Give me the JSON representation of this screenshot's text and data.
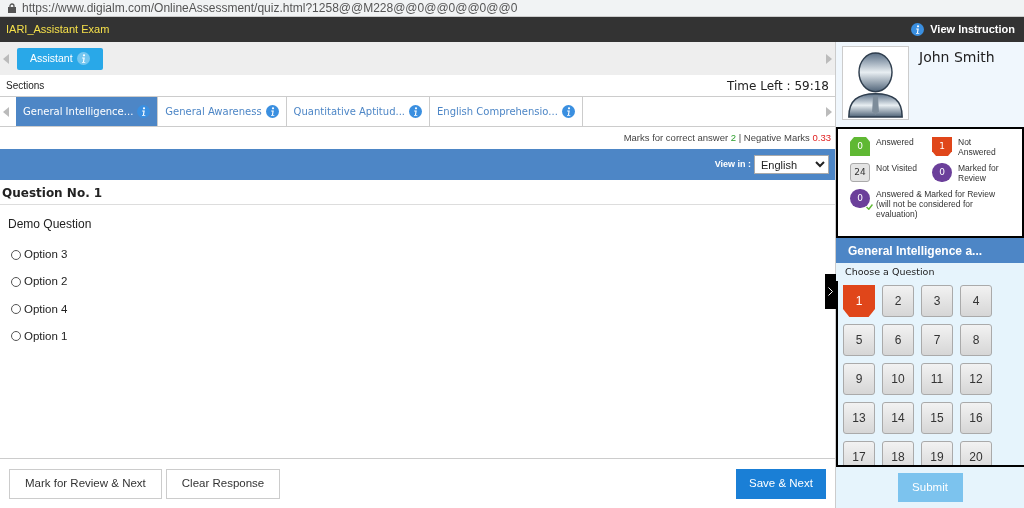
{
  "address_bar": {
    "url": "https://www.digialm.com/OnlineAssessment/quiz.html?1258@@M228@@0@@0@@0@@0"
  },
  "header": {
    "exam_title": "IARI_Assistant Exam",
    "instructions_link": "View Instruction"
  },
  "groups": [
    {
      "label": "Assistant",
      "selected": true
    }
  ],
  "sections_label": "Sections",
  "time_left": "Time Left : 59:18",
  "section_tabs": [
    {
      "label": "General Intelligence...",
      "selected": true
    },
    {
      "label": "General Awareness",
      "selected": false
    },
    {
      "label": "Quantitative Aptitud...",
      "selected": false
    },
    {
      "label": "English Comprehensio...",
      "selected": false
    }
  ],
  "marks": {
    "correct_label": "Marks for correct answer",
    "correct_value": "2",
    "separator": "|",
    "negative_label": "Negative Marks",
    "negative_value": "0.33"
  },
  "view_in": {
    "label": "View in :",
    "value": "English"
  },
  "question": {
    "number": "Question No. 1",
    "text": "Demo Question",
    "options": [
      {
        "label": "Option 3",
        "selected": false
      },
      {
        "label": "Option 2",
        "selected": false
      },
      {
        "label": "Option 4",
        "selected": false
      },
      {
        "label": "Option 1",
        "selected": false
      }
    ]
  },
  "buttons": {
    "mark_review": "Mark for Review & Next",
    "clear": "Clear Response",
    "save": "Save & Next",
    "submit": "Submit"
  },
  "candidate": {
    "name": "John Smith"
  },
  "legend": [
    {
      "kind": "answered",
      "count": "0",
      "label": "Answered"
    },
    {
      "kind": "not_answered",
      "count": "1",
      "label": "Not Answered"
    },
    {
      "kind": "not_visited",
      "count": "24",
      "label": "Not Visited"
    },
    {
      "kind": "marked",
      "count": "0",
      "label": "Marked for Review"
    },
    {
      "kind": "answered_marked",
      "count": "0",
      "label": "Answered & Marked for Review (will not be considered for evaluation)"
    }
  ],
  "palette": {
    "section_title": "General Intelligence a...",
    "heading": "Choose a Question",
    "questions": [
      {
        "number": "1",
        "kind": "not_answered"
      },
      {
        "number": "2",
        "kind": "not_visited"
      },
      {
        "number": "3",
        "kind": "not_visited"
      },
      {
        "number": "4",
        "kind": "not_visited"
      },
      {
        "number": "5",
        "kind": "not_visited"
      },
      {
        "number": "6",
        "kind": "not_visited"
      },
      {
        "number": "7",
        "kind": "not_visited"
      },
      {
        "number": "8",
        "kind": "not_visited"
      },
      {
        "number": "9",
        "kind": "not_visited"
      },
      {
        "number": "10",
        "kind": "not_visited"
      },
      {
        "number": "11",
        "kind": "not_visited"
      },
      {
        "number": "12",
        "kind": "not_visited"
      },
      {
        "number": "13",
        "kind": "not_visited"
      },
      {
        "number": "14",
        "kind": "not_visited"
      },
      {
        "number": "15",
        "kind": "not_visited"
      },
      {
        "number": "16",
        "kind": "not_visited"
      },
      {
        "number": "17",
        "kind": "not_visited"
      },
      {
        "number": "18",
        "kind": "not_visited"
      },
      {
        "number": "19",
        "kind": "not_visited"
      },
      {
        "number": "20",
        "kind": "not_visited"
      }
    ]
  }
}
